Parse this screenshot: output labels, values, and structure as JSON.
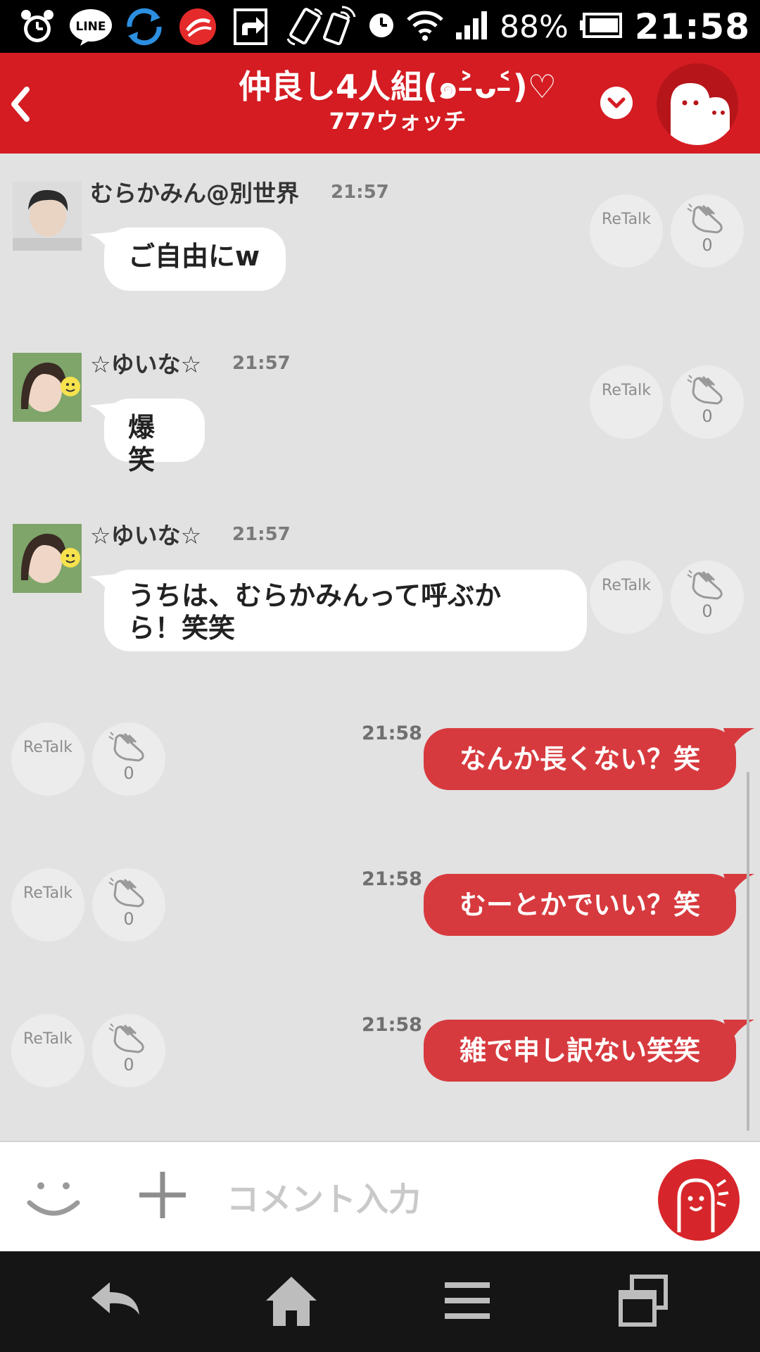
{
  "status_bar": {
    "battery_percent": "88%",
    "time": "21:58",
    "line_badge": "LINE",
    "apps": [
      "alarm-icon",
      "line-icon",
      "sync-icon",
      "security-icon",
      "share-icon",
      "rotate-icon"
    ],
    "system": [
      "nfc-icon",
      "clock-icon",
      "wifi-icon",
      "signal-icon",
      "battery-icon"
    ]
  },
  "header": {
    "title": "仲良し4人組(๑˃̵ᴗ˂̵)♡",
    "subtitle": "777ウォッチ",
    "back_label": "‹"
  },
  "messages_in": [
    {
      "sender": "むらかみん@別世界",
      "time": "21:57",
      "text": "ご自由にw",
      "retalk": "ReTalk",
      "claps": "0"
    },
    {
      "sender": "☆ゆいな☆",
      "time": "21:57",
      "text": "爆笑",
      "retalk": "ReTalk",
      "claps": "0"
    },
    {
      "sender": "☆ゆいな☆",
      "time": "21:57",
      "text": "うちは、むらかみんって呼ぶから！笑笑",
      "retalk": "ReTalk",
      "claps": "0"
    }
  ],
  "messages_out": [
    {
      "time": "21:58",
      "text": "なんか長くない？笑",
      "retalk": "ReTalk",
      "claps": "0"
    },
    {
      "time": "21:58",
      "text": "むーとかでいい？笑",
      "retalk": "ReTalk",
      "claps": "0"
    },
    {
      "time": "21:58",
      "text": "雑で申し訳ない笑笑",
      "retalk": "ReTalk",
      "claps": "0"
    }
  ],
  "input": {
    "placeholder": "コメント入力"
  },
  "colors": {
    "header_red": "#d41c22",
    "bubble_out": "#d73a3e",
    "chat_bg": "#e2e2e2"
  }
}
